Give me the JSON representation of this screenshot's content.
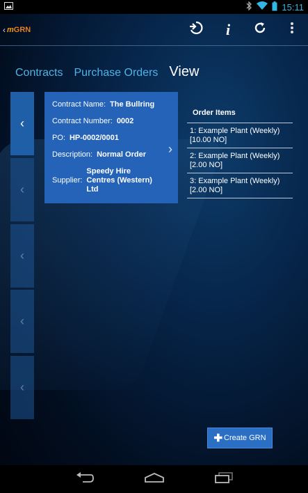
{
  "status_bar": {
    "time": "15:11",
    "icons": [
      "image-icon",
      "bluetooth-icon",
      "wifi-icon",
      "battery-icon"
    ]
  },
  "action_bar": {
    "app_name_m": "m",
    "app_name_rest": "GRN",
    "actions": [
      "logout-icon",
      "info-icon",
      "refresh-icon",
      "overflow-menu-icon"
    ]
  },
  "breadcrumb": {
    "contracts": "Contracts",
    "purchase_orders": "Purchase Orders",
    "current": "View"
  },
  "detail": {
    "contract_name_label": "Contract Name:",
    "contract_name": "The Bullring",
    "contract_number_label": "Contract Number:",
    "contract_number": "0002",
    "po_label": "PO:",
    "po": "HP-0002/0001",
    "description_label": "Description:",
    "description": "Normal Order",
    "supplier_label": "Supplier:",
    "supplier": "Speedy Hire Centres (Western) Ltd"
  },
  "order_items": {
    "title": "Order Items",
    "items": [
      {
        "text": "1: Example Plant (Weekly) [10.00 NO]"
      },
      {
        "text": "2: Example Plant (Weekly) [2.00 NO]"
      },
      {
        "text": "3: Example Plant (Weekly) [2.00 NO]"
      }
    ]
  },
  "create_button": {
    "label": "Create GRN"
  },
  "colors": {
    "accent": "#4fb3e8",
    "card": "#2563b8",
    "button": "#2b6fc4",
    "status_accent": "#33b5e5"
  }
}
